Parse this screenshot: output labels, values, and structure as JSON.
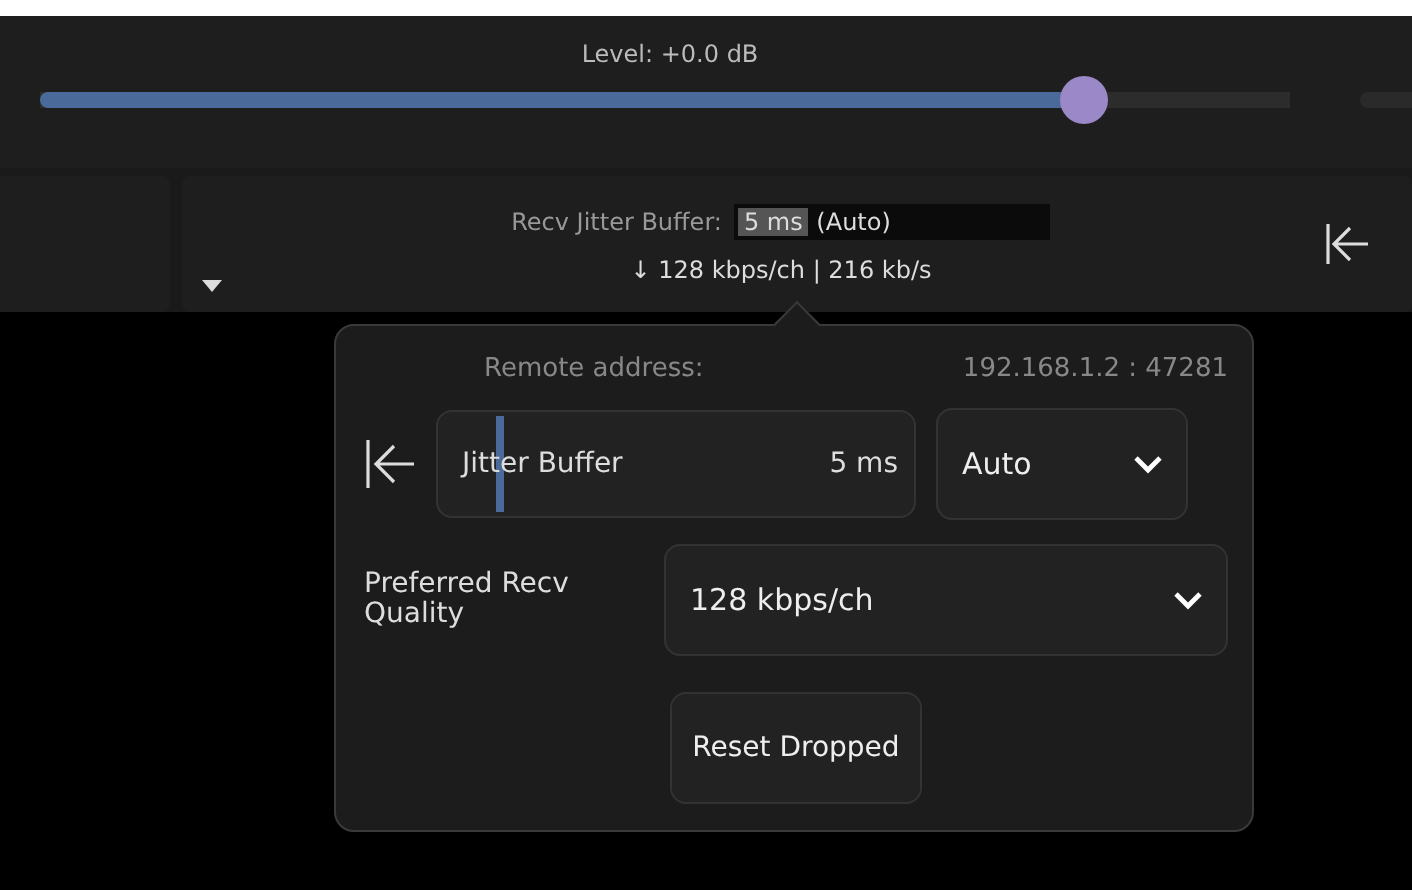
{
  "level_label": "Level: +0.0 dB",
  "level_slider": {
    "level": 0.835
  },
  "recv": {
    "label": "Recv Jitter Buffer:",
    "value": "5 ms",
    "mode": "(Auto)",
    "rate": "↓ 128 kbps/ch | 216 kb/s"
  },
  "popover": {
    "remote_label": "Remote address:",
    "remote_value": "192.168.1.2 : 47281",
    "jitter": {
      "label": "Jitter Buffer",
      "value": "5 ms",
      "level": 0.12,
      "mode": "Auto"
    },
    "quality": {
      "label": "Preferred Recv Quality",
      "value": "128 kbps/ch"
    },
    "reset_button": "Reset Dropped"
  }
}
